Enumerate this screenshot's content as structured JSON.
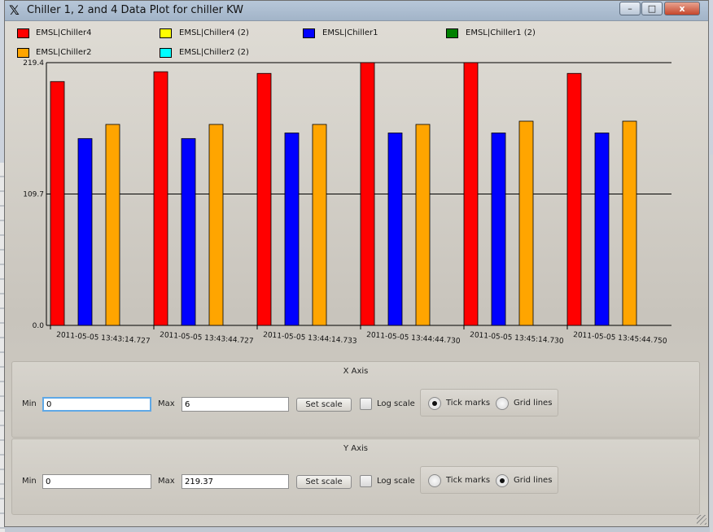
{
  "window": {
    "title": "Chiller 1, 2 and 4 Data Plot for chiller KW",
    "minimize_label": "–",
    "maximize_label": "□",
    "close_label": "x"
  },
  "legend": [
    {
      "label": "EMSL|Chiller4",
      "color": "#ff0000"
    },
    {
      "label": "EMSL|Chiller4 (2)",
      "color": "#ffff00"
    },
    {
      "label": "EMSL|Chiller1",
      "color": "#0000ff"
    },
    {
      "label": "EMSL|Chiller1 (2)",
      "color": "#008000"
    },
    {
      "label": "EMSL|Chiller2",
      "color": "#ffa500"
    },
    {
      "label": "EMSL|Chiller2 (2)",
      "color": "#00ffff"
    }
  ],
  "chart_data": {
    "type": "bar",
    "categories": [
      "2011-05-05 13:43:14.727",
      "2011-05-05 13:43:44.727",
      "2011-05-05 13:44:14.733",
      "2011-05-05 13:44:44.730",
      "2011-05-05 13:45:14.730",
      "2011-05-05 13:45:44.750"
    ],
    "series": [
      {
        "name": "EMSL|Chiller4",
        "color": "#ff0000",
        "values": [
          203.6,
          211.8,
          210.4,
          219.4,
          219.4,
          210.4
        ]
      },
      {
        "name": "EMSL|Chiller1",
        "color": "#0000ff",
        "values": [
          156.0,
          156.0,
          160.7,
          160.7,
          160.7,
          160.7
        ]
      },
      {
        "name": "EMSL|Chiller2",
        "color": "#ffa500",
        "values": [
          167.8,
          167.8,
          167.8,
          167.8,
          170.5,
          170.5
        ]
      }
    ],
    "y_ticks": [
      "219.4",
      "109.7",
      "0.0"
    ],
    "ylim": [
      0,
      219.4
    ],
    "grid": true
  },
  "x_axis_panel": {
    "title": "X Axis",
    "min_label": "Min",
    "min_value": "0",
    "max_label": "Max",
    "max_value": "6",
    "set_scale_label": "Set scale",
    "log_scale_label": "Log scale",
    "tick_marks_label": "Tick marks",
    "grid_lines_label": "Grid lines",
    "selected": "Tick marks"
  },
  "y_axis_panel": {
    "title": "Y Axis",
    "min_label": "Min",
    "min_value": "0",
    "max_label": "Max",
    "max_value": "219.37",
    "set_scale_label": "Set scale",
    "log_scale_label": "Log scale",
    "tick_marks_label": "Tick marks",
    "grid_lines_label": "Grid lines",
    "selected": "Grid lines"
  }
}
